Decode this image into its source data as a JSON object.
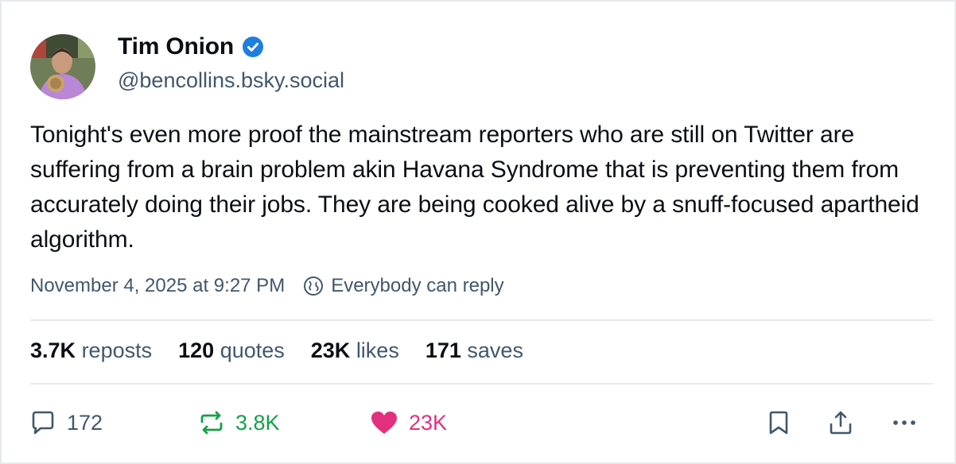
{
  "post": {
    "author_name": "Tim Onion",
    "handle": "@bencollins.bsky.social",
    "text": "Tonight's even more proof the mainstream reporters who are still on Twitter are suffering from a brain problem akin Havana Syndrome that is preventing them from accurately doing their jobs. They are being cooked alive by a snuff-focused apartheid algorithm.",
    "timestamp": "November 4, 2025 at 9:27 PM",
    "reply_setting": "Everybody can reply"
  },
  "stats": {
    "reposts_count": "3.7K",
    "reposts_label": "reposts",
    "quotes_count": "120",
    "quotes_label": "quotes",
    "likes_count": "23K",
    "likes_label": "likes",
    "saves_count": "171",
    "saves_label": "saves"
  },
  "actions": {
    "reply_count": "172",
    "repost_count": "3.8K",
    "like_count": "23K"
  },
  "icons": {
    "verified": "verified-badge-icon",
    "globe": "globe-icon",
    "reply": "speech-bubble-icon",
    "repost": "repost-arrows-icon",
    "like": "heart-icon",
    "bookmark": "bookmark-icon",
    "share": "share-icon",
    "more": "more-dots-icon"
  },
  "colors": {
    "verified_blue": "#1d7fe0",
    "repost_green": "#14a14a",
    "like_pink": "#e3307e",
    "muted_text": "#42576c"
  }
}
